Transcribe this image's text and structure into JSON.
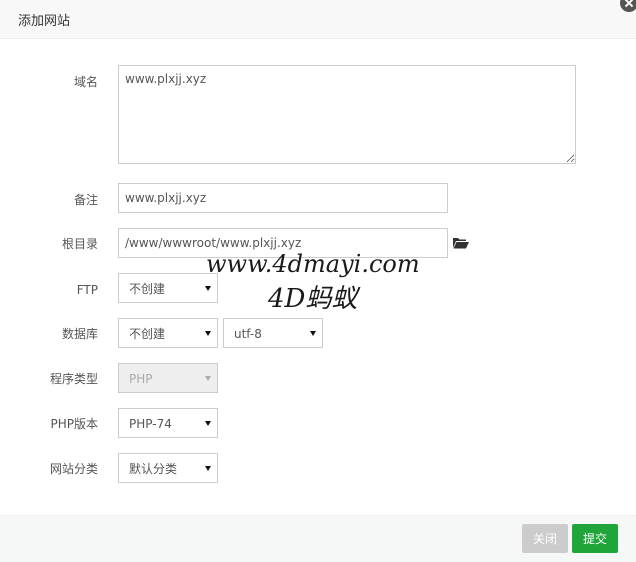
{
  "dialog": {
    "title": "添加网站"
  },
  "form": {
    "domain": {
      "label": "域名",
      "value": "www.plxjj.xyz"
    },
    "remark": {
      "label": "备注",
      "value": "www.plxjj.xyz"
    },
    "root_dir": {
      "label": "根目录",
      "value": "/www/wwwroot/www.plxjj.xyz"
    },
    "ftp": {
      "label": "FTP",
      "selected": "不创建"
    },
    "database": {
      "label": "数据库",
      "selected": "不创建",
      "charset": "utf-8"
    },
    "program_type": {
      "label": "程序类型",
      "selected": "PHP"
    },
    "php_version": {
      "label": "PHP版本",
      "selected": "PHP-74"
    },
    "site_category": {
      "label": "网站分类",
      "selected": "默认分类"
    }
  },
  "watermark": {
    "url": "www.4dmayi.com",
    "name": "4D蚂蚁"
  },
  "footer": {
    "close_label": "关闭",
    "submit_label": "提交"
  },
  "colors": {
    "submit": "#20a53a",
    "close": "#cccccc"
  },
  "icons": {
    "dialog_close": "close-icon",
    "browse": "folder-open-icon",
    "dropdown": "caret-down-icon"
  }
}
